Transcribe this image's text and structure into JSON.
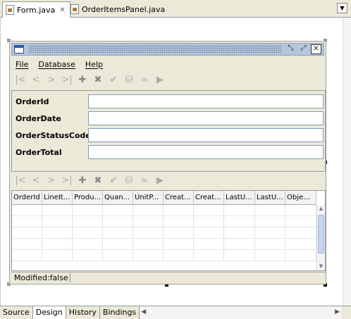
{
  "editor_tabs": [
    {
      "label": "Form.java",
      "active": true
    },
    {
      "label": "OrderItemsPanel.java",
      "active": false
    }
  ],
  "form": {
    "menus": [
      "File",
      "Database",
      "Help"
    ],
    "fields": [
      {
        "label": "OrderId",
        "value": ""
      },
      {
        "label": "OrderDate",
        "value": ""
      },
      {
        "label": "OrderStatusCode",
        "value": ""
      },
      {
        "label": "OrderTotal",
        "value": ""
      }
    ],
    "toolbar_icons": [
      "first-record-icon",
      "previous-record-icon",
      "next-record-icon",
      "last-record-icon",
      "insert-record-icon",
      "delete-record-icon",
      "commit-icon",
      "rollback-icon",
      "find-icon",
      "execute-query-icon"
    ],
    "grid_columns": [
      "OrderId",
      "LineIt...",
      "Produ...",
      "Quan...",
      "UnitP...",
      "Creat...",
      "Creat...",
      "LastU...",
      "LastU...",
      "Obje..."
    ],
    "status_text": "Modified:false"
  },
  "bottom_tabs": [
    {
      "label": "Source",
      "active": false
    },
    {
      "label": "Design",
      "active": true
    },
    {
      "label": "History",
      "active": false
    },
    {
      "label": "Bindings",
      "active": false
    }
  ]
}
